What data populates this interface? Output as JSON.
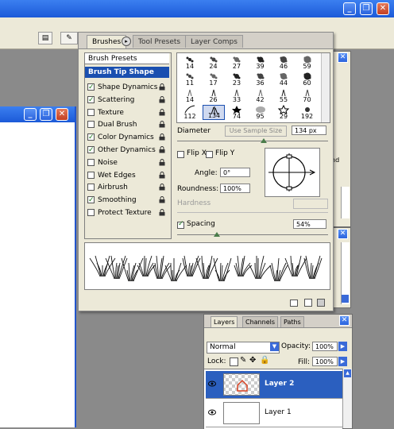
{
  "window": {
    "minimize_icon": "minimize-icon",
    "restore_icon": "restore-icon",
    "close_icon": "close-icon"
  },
  "brushes": {
    "tabs": [
      {
        "label": "Brushes"
      },
      {
        "label": "Tool Presets"
      },
      {
        "label": "Layer Comps"
      }
    ],
    "brush_presets": "Brush Presets",
    "brush_tip_shape": "Brush Tip Shape",
    "options": [
      {
        "label": "Shape Dynamics",
        "checked": true
      },
      {
        "label": "Scattering",
        "checked": true
      },
      {
        "label": "Texture",
        "checked": false
      },
      {
        "label": "Dual Brush",
        "checked": false
      },
      {
        "label": "Color Dynamics",
        "checked": true
      },
      {
        "label": "Other Dynamics",
        "checked": true
      },
      {
        "label": "Noise",
        "checked": false
      },
      {
        "label": "Wet Edges",
        "checked": false
      },
      {
        "label": "Airbrush",
        "checked": false
      },
      {
        "label": "Smoothing",
        "checked": true
      },
      {
        "label": "Protect Texture",
        "checked": false
      }
    ],
    "brush_grid": {
      "rows": [
        [
          "14",
          "24",
          "27",
          "39",
          "46",
          "59"
        ],
        [
          "11",
          "17",
          "23",
          "36",
          "44",
          "60"
        ],
        [
          "14",
          "26",
          "33",
          "42",
          "55",
          "70"
        ],
        [
          "112",
          "134",
          "74",
          "95",
          "29",
          "192"
        ]
      ]
    },
    "diameter_label": "Diameter",
    "use_sample_size": "Use Sample Size",
    "diameter_value": "134 px",
    "flip_x": "Flip X",
    "flip_y": "Flip Y",
    "angle_label": "Angle:",
    "angle_value": "0°",
    "roundness_label": "Roundness:",
    "roundness_value": "100%",
    "hardness_label": "Hardness",
    "spacing_label": "Spacing",
    "spacing_value": "54%"
  },
  "layers": {
    "tabs": [
      {
        "label": "Layers"
      },
      {
        "label": "Channels"
      },
      {
        "label": "Paths"
      }
    ],
    "blend_mode": "Normal",
    "opacity_label": "Opacity:",
    "opacity_value": "100%",
    "lock_label": "Lock:",
    "fill_label": "Fill:",
    "fill_value": "100%",
    "items": [
      {
        "name": "Layer 2",
        "selected": true
      },
      {
        "name": "Layer 1",
        "selected": false
      }
    ]
  },
  "background_panel": {
    "partial_text": "nd"
  }
}
